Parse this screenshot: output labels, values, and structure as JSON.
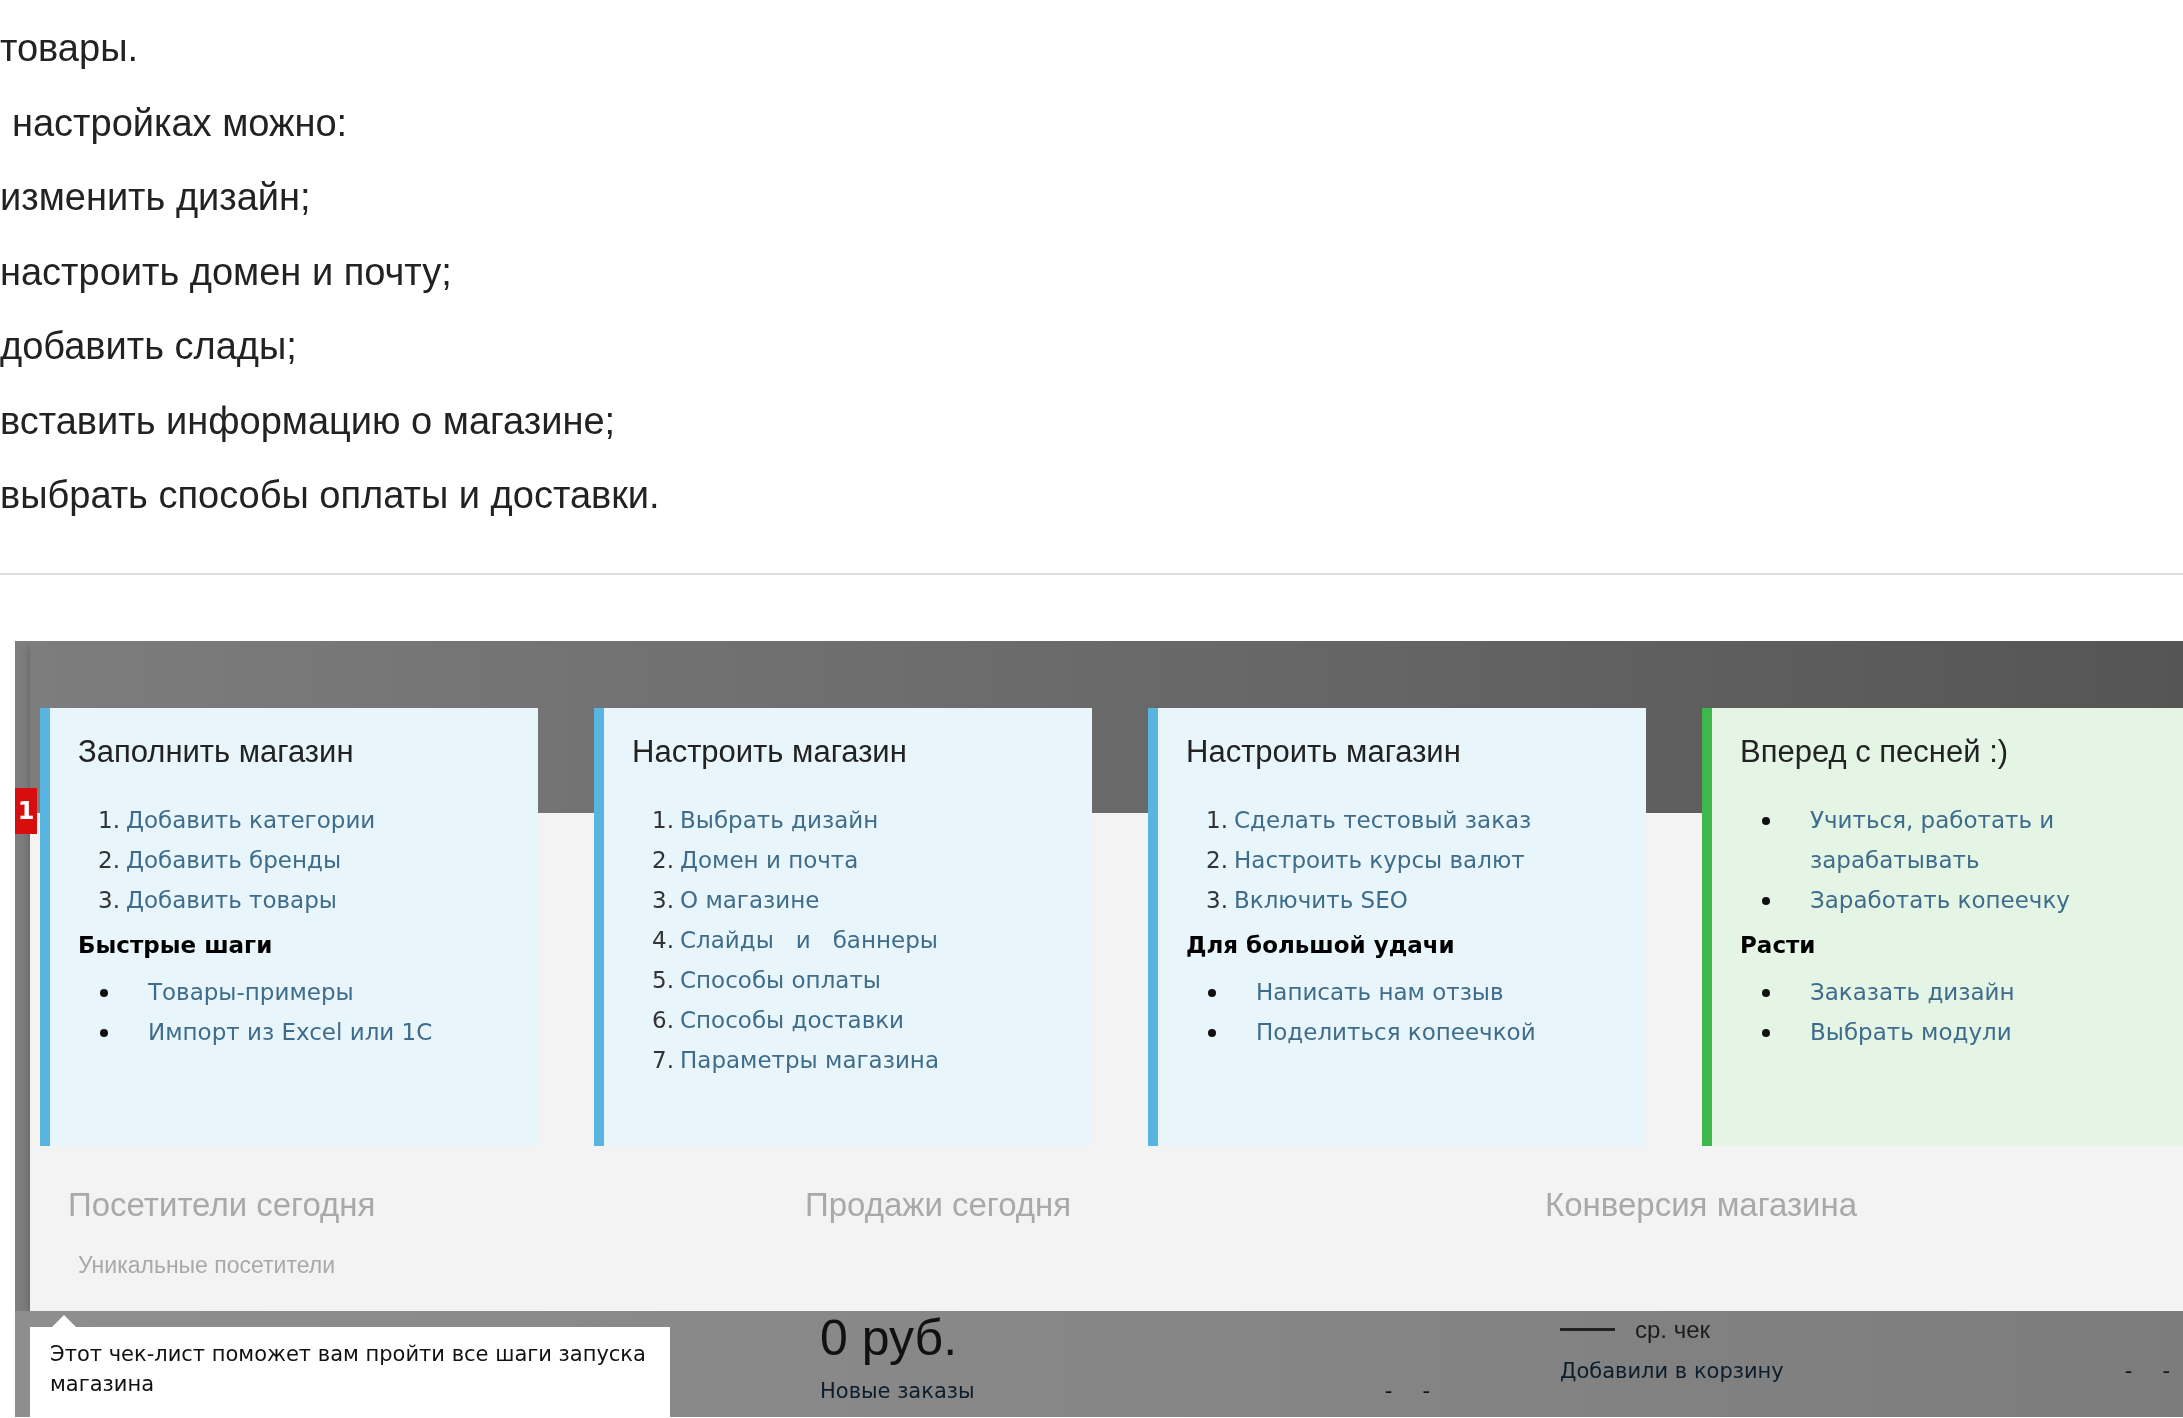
{
  "article": {
    "lines": [
      {
        "text": "товары.",
        "indented": false
      },
      {
        "text": "настройках можно:",
        "indented": true
      },
      {
        "text": "изменить дизайн;",
        "indented": false
      },
      {
        "text": "настроить домен и почту;",
        "indented": false
      },
      {
        "text": "добавить слады;",
        "indented": false
      },
      {
        "text": "вставить информацию о магазине;",
        "indented": false
      },
      {
        "text": "выбрать способы оплаты и доставки.",
        "indented": false
      }
    ]
  },
  "checklist": {
    "badge": "1",
    "cards": [
      {
        "title": "Заполнить магазин",
        "color": "#5ab4e0",
        "sections": [
          {
            "items": [
              {
                "number": "1.",
                "label": "Добавить категории"
              },
              {
                "number": "2.",
                "label": "Добавить бренды"
              },
              {
                "number": "3.",
                "label": "Добавить товары"
              }
            ]
          },
          {
            "heading": "Быстрые шаги",
            "items": [
              {
                "label": "Товары-примеры"
              },
              {
                "label": "Импорт из Excel или 1С"
              }
            ]
          }
        ]
      },
      {
        "title": "Настроить магазин",
        "color": "#5ab4e0",
        "sections": [
          {
            "items": [
              {
                "number": "1.",
                "label": "Выбрать дизайн"
              },
              {
                "number": "2.",
                "label": "Домен и почта"
              },
              {
                "number": "3.",
                "label": "О магазине"
              },
              {
                "number": "4.",
                "label": "Слайды   и   баннеры"
              },
              {
                "number": "5.",
                "label": "Способы оплаты"
              },
              {
                "number": "6.",
                "label": "Способы доставки"
              },
              {
                "number": "7.",
                "label": "Параметры магазина"
              }
            ]
          }
        ]
      },
      {
        "title": "Настроить магазин",
        "color": "#5ab4e0",
        "sections": [
          {
            "items": [
              {
                "number": "1.",
                "label": "Сделать тестовый заказ"
              },
              {
                "number": "2.",
                "label": "Настроить курсы валют"
              },
              {
                "number": "3.",
                "label": "Включить SEO"
              }
            ]
          },
          {
            "heading": "Для большой удачи",
            "items": [
              {
                "label": "Написать нам отзыв"
              },
              {
                "label": "Поделиться копеечкой"
              }
            ]
          }
        ]
      },
      {
        "title": "Вперед с песней :)",
        "color": "#3cb94a",
        "sections": [
          {
            "items": [
              {
                "label": "Учиться, работать и зарабатывать"
              },
              {
                "label": "Заработать копеечку"
              }
            ]
          },
          {
            "heading": "Расти",
            "items": [
              {
                "label": "Заказать дизайн"
              },
              {
                "label": "Выбрать модули"
              }
            ]
          }
        ]
      }
    ]
  },
  "dashboard": {
    "columns": [
      {
        "title": "Посетители сегодня",
        "caption": "Уникальные посетители"
      },
      {
        "title": "Продажи сегодня",
        "value": "0 руб.",
        "metric": {
          "label": "Новые заказы",
          "values": [
            "-",
            "-"
          ]
        }
      },
      {
        "title": "Конверсия магазина",
        "legend": "ср. чек",
        "metric": {
          "label": "Добавили в корзину",
          "values": [
            "-",
            "-"
          ]
        }
      }
    ]
  },
  "tooltip": {
    "text": "Этот чек-лист поможет вам пройти все шаги запуска магазина"
  }
}
